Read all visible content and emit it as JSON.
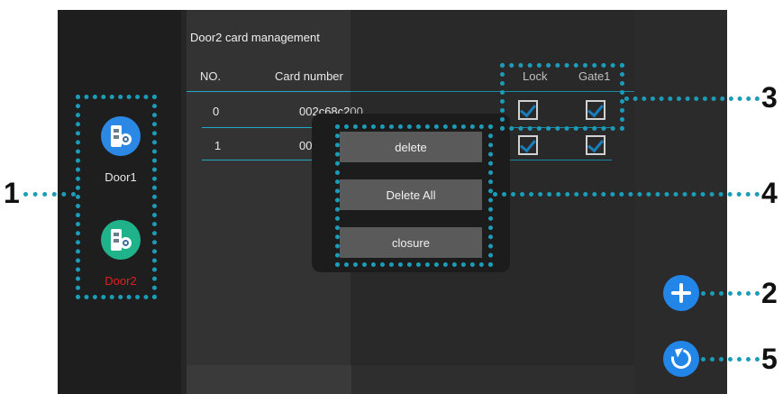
{
  "sidebar": {
    "doors": [
      {
        "label": "Door1",
        "color": "#e8e8e8",
        "icon_bg": "#2b88e4"
      },
      {
        "label": "Door2",
        "color": "#e02020",
        "icon_bg": "#20b28a"
      }
    ]
  },
  "page": {
    "title": "Door2 card management"
  },
  "table": {
    "columns": {
      "no": "NO.",
      "card": "Card number",
      "lock": "Lock",
      "gate": "Gate1"
    },
    "rows": [
      {
        "no": "0",
        "card": "002c68c200",
        "lock": true,
        "gate": true
      },
      {
        "no": "1",
        "card": "002d2",
        "lock": true,
        "gate": true
      }
    ]
  },
  "popup": {
    "delete": "delete",
    "delete_all": "Delete All",
    "closure": "closure"
  },
  "callouts": [
    "1",
    "2",
    "3",
    "4",
    "5"
  ],
  "colors": {
    "accent": "#2286e8",
    "annotation": "#1b9db9",
    "line": "#1fa8c9"
  }
}
